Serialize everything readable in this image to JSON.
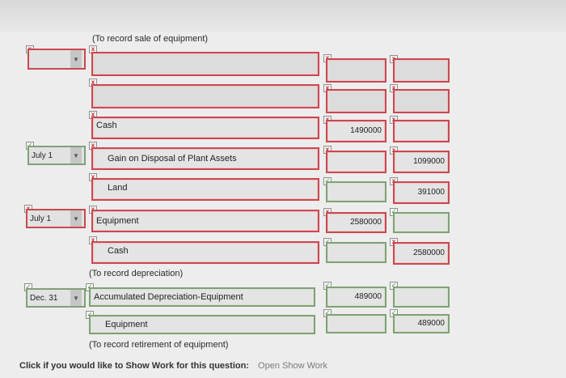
{
  "notes": {
    "sale": "(To record sale of equipment)",
    "depreciation": "(To record depreciation)",
    "retirement": "(To record retirement of equipment)"
  },
  "entries": {
    "r1": {
      "date": "",
      "account": "",
      "debit": "",
      "credit": ""
    },
    "r2": {
      "account": "",
      "debit": "",
      "credit": ""
    },
    "r3": {
      "account": "Cash",
      "debit": "1490000",
      "credit": ""
    },
    "r4": {
      "date": "July 1",
      "account": "Gain on Disposal of Plant Assets",
      "debit": "",
      "credit": "1099000"
    },
    "r5": {
      "account": "Land",
      "debit": "",
      "credit": "391000"
    },
    "r6": {
      "date": "July 1",
      "account": "Equipment",
      "debit": "2580000",
      "credit": ""
    },
    "r7": {
      "account": "Cash",
      "debit": "",
      "credit": "2580000"
    },
    "r8": {
      "date": "Dec. 31",
      "account": "Accumulated Depreciation-Equipment",
      "debit": "489000",
      "credit": ""
    },
    "r9": {
      "account": "Equipment",
      "debit": "",
      "credit": "489000"
    }
  },
  "footer": {
    "prompt": "Click if you would like to Show Work for this question:",
    "link": "Open Show Work"
  },
  "icons": {
    "wrong": "wrong-mark-icon",
    "correct": "correct-mark-icon"
  },
  "colors": {
    "wrong": "#c9494f",
    "correct": "#7fa176"
  }
}
